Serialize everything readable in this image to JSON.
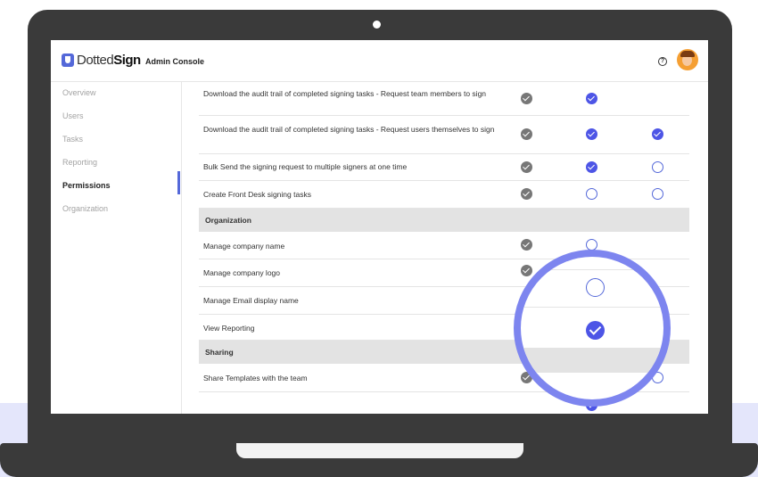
{
  "app": {
    "logo_word1": "Dotted",
    "logo_word2": "Sign",
    "console_title": "Admin Console",
    "help_icon": "?"
  },
  "sidebar": {
    "items": [
      {
        "label": "Overview"
      },
      {
        "label": "Users"
      },
      {
        "label": "Tasks"
      },
      {
        "label": "Reporting"
      },
      {
        "label": "Permissions",
        "active": true
      },
      {
        "label": "Organization"
      }
    ]
  },
  "permissions": {
    "rows": [
      {
        "label": "Download the audit trail of completed signing tasks - Request team members to sign",
        "checks": [
          "on-gray",
          "on-blue",
          "none"
        ]
      },
      {
        "label": "Download the audit trail of completed signing tasks - Request users themselves to sign",
        "checks": [
          "on-gray",
          "on-blue",
          "on-blue"
        ]
      },
      {
        "label": "Bulk Send the signing request to multiple signers at one time",
        "checks": [
          "on-gray",
          "on-blue",
          "off"
        ]
      },
      {
        "label": "Create Front Desk signing tasks",
        "checks": [
          "on-gray",
          "off",
          "off"
        ]
      }
    ],
    "section_organization": "Organization",
    "org_rows": [
      {
        "label": "Manage company name"
      },
      {
        "label": "Manage company logo"
      },
      {
        "label": "Manage Email display name"
      },
      {
        "label": "View Reporting"
      }
    ],
    "section_sharing": "Sharing",
    "sharing_rows": [
      {
        "label": "Share Templates with the team"
      }
    ]
  },
  "colors": {
    "accent": "#5468d9",
    "check_blue": "#4d55e6",
    "check_gray": "#777777",
    "magnifier_ring": "#7d85ef",
    "section_bg": "#e3e3e3"
  }
}
